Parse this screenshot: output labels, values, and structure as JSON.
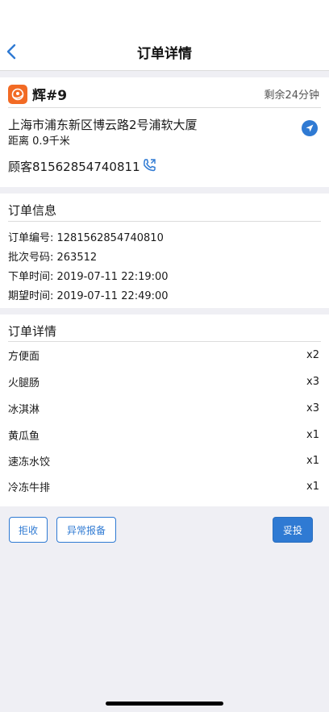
{
  "header": {
    "title": "订单详情",
    "back_icon": "chevron-left-icon"
  },
  "store": {
    "logo_icon": "store-logo-icon",
    "name": "辉#9",
    "remaining_time": "剩余24分钟",
    "address": "上海市浦东新区博云路2号浦软大厦",
    "distance": "距离 0.9千米",
    "navigate_icon": "navigation-arrow-icon",
    "customer": "顾客81562854740811",
    "phone_icon": "phone-icon"
  },
  "order_info": {
    "title": "订单信息",
    "rows": [
      "订单编号: 1281562854740810",
      "批次号码: 263512",
      "下单时间: 2019-07-11 22:19:00",
      "期望时间: 2019-07-11 22:49:00"
    ]
  },
  "order_items": {
    "title": "订单详情",
    "items": [
      {
        "name": "方便面",
        "qty": "x2"
      },
      {
        "name": "火腿肠",
        "qty": "x3"
      },
      {
        "name": "冰淇淋",
        "qty": "x3"
      },
      {
        "name": "黄瓜鱼",
        "qty": "x1"
      },
      {
        "name": "速冻水饺",
        "qty": "x1"
      },
      {
        "name": "冷冻牛排",
        "qty": "x1"
      }
    ]
  },
  "actions": {
    "reject_label": "拒收",
    "report_label": "异常报备",
    "deliver_label": "妥投"
  },
  "colors": {
    "accent": "#2f7ad3",
    "logo": "#f26a24",
    "background": "#efeff4"
  }
}
